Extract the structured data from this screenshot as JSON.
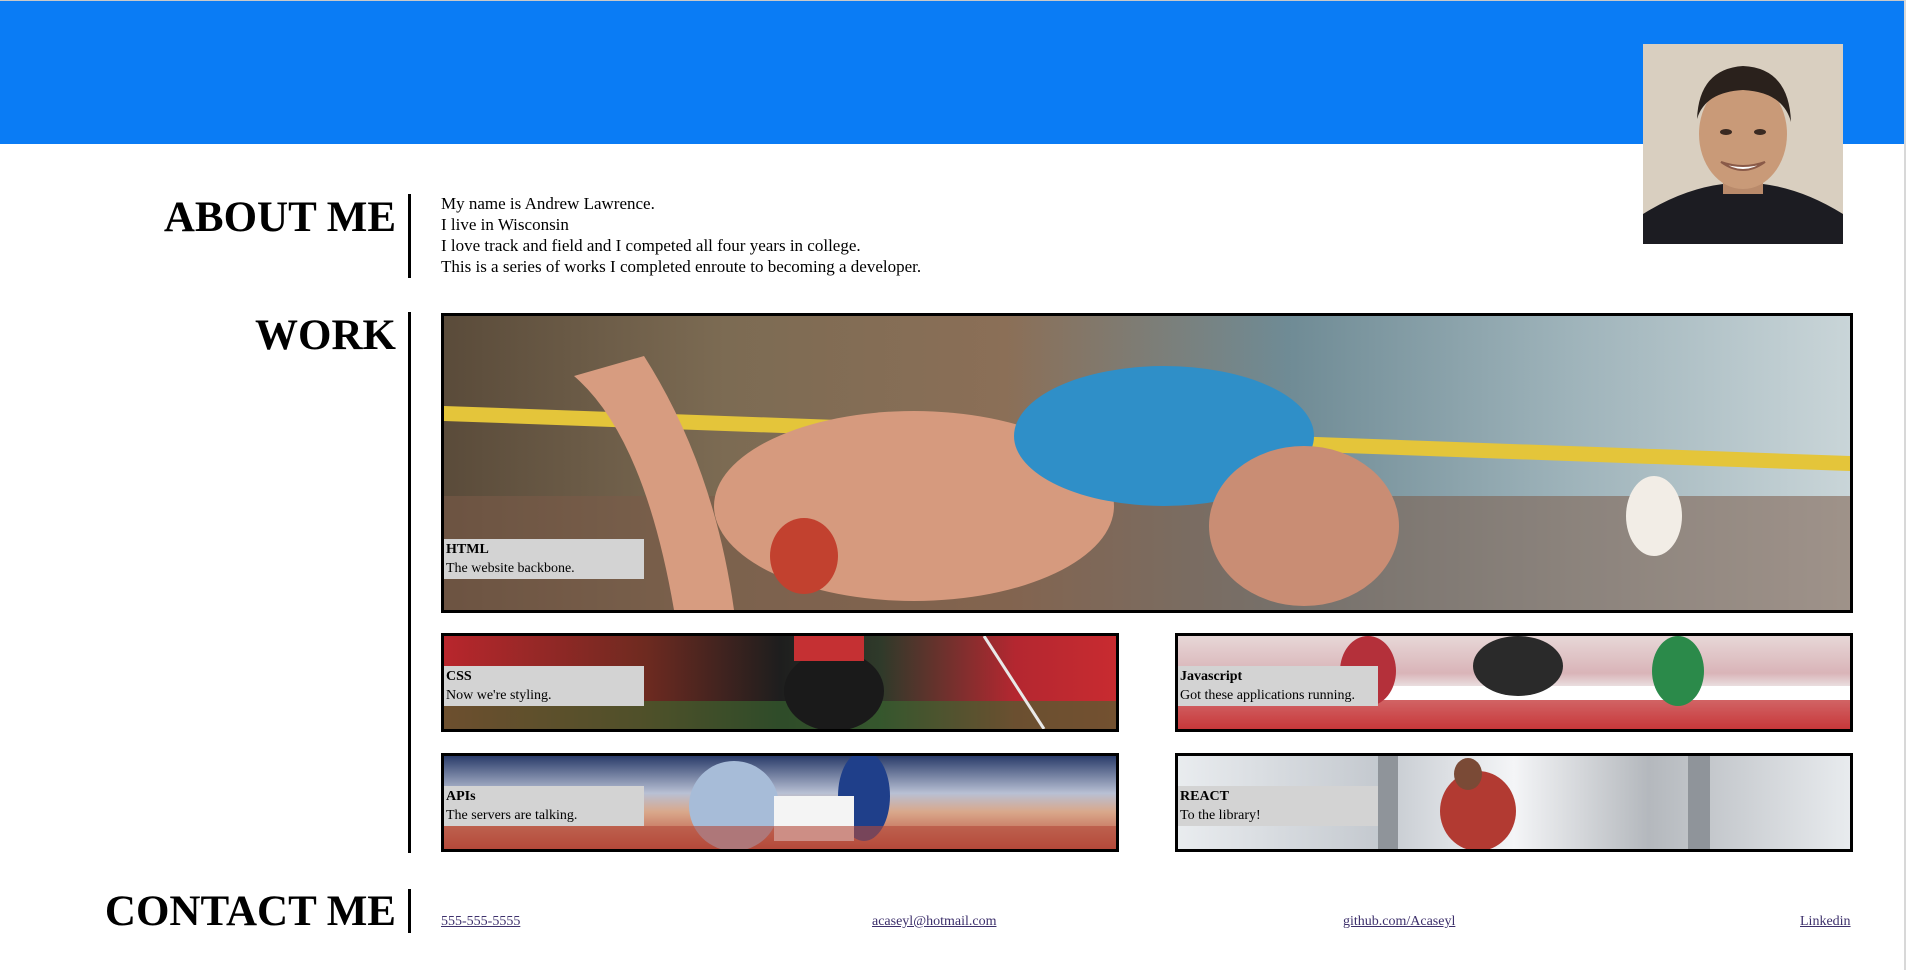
{
  "about": {
    "title": "ABOUT ME",
    "lines": [
      "My name is Andrew Lawrence.",
      "I live in Wisconsin",
      "I love track and field and I competed all four years in college.",
      "This is a series of works I completed enroute to becoming a developer."
    ]
  },
  "work": {
    "title": "WORK",
    "cards": [
      {
        "title": "HTML",
        "desc": "The website backbone."
      },
      {
        "title": "CSS",
        "desc": "Now we're styling."
      },
      {
        "title": "Javascript",
        "desc": "Got these applications running."
      },
      {
        "title": "APIs",
        "desc": "The servers are talking."
      },
      {
        "title": "REACT",
        "desc": "To the library!"
      }
    ]
  },
  "contact": {
    "title": "CONTACT ME",
    "phone": "555-555-5555",
    "email": "acaseyl@hotmail.com",
    "github": "github.com/Acaseyl",
    "linkedin": "Linkedin"
  },
  "colors": {
    "header": "#0a7cf5",
    "caption_bg": "#d3d3d3",
    "link": "#3c2f6b"
  }
}
